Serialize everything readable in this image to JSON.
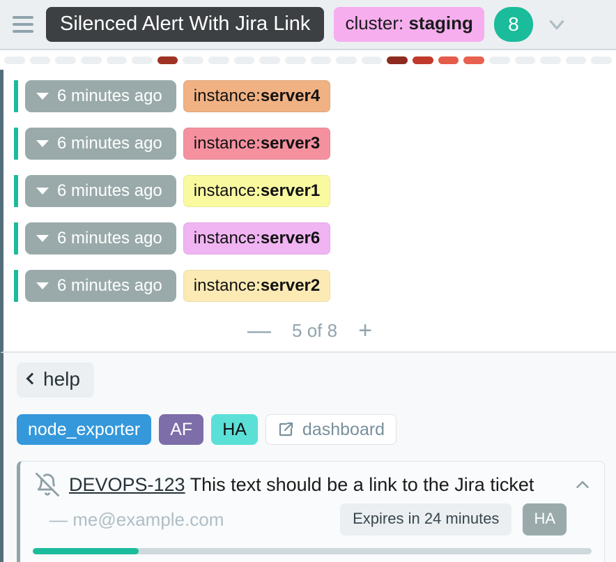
{
  "header": {
    "menu_icon": "hamburger-icon",
    "alert_title": "Silenced Alert With Jira Link",
    "cluster_key": "cluster: ",
    "cluster_value": "staging",
    "count": "8",
    "expand_icon": "chevron-down-icon"
  },
  "timeline": {
    "segments": [
      {
        "color": "#eceff1"
      },
      {
        "color": "#eceff1"
      },
      {
        "color": "#eceff1"
      },
      {
        "color": "#eceff1"
      },
      {
        "color": "#eceff1"
      },
      {
        "color": "#eceff1"
      },
      {
        "color": "#9e3224"
      },
      {
        "color": "#eceff1"
      },
      {
        "color": "#eceff1"
      },
      {
        "color": "#eceff1"
      },
      {
        "color": "#eceff1"
      },
      {
        "color": "#eceff1"
      },
      {
        "color": "#eceff1"
      },
      {
        "color": "#eceff1"
      },
      {
        "color": "#eceff1"
      },
      {
        "color": "#8e2b20"
      },
      {
        "color": "#c0392b"
      },
      {
        "color": "#e35b4a"
      },
      {
        "color": "#e8604e"
      },
      {
        "color": "#eceff1"
      },
      {
        "color": "#eceff1"
      },
      {
        "color": "#eceff1"
      },
      {
        "color": "#eceff1"
      },
      {
        "color": "#eceff1"
      }
    ]
  },
  "alerts": {
    "rows": [
      {
        "time": "6 minutes ago",
        "label_key": "instance: ",
        "label_value": "server4",
        "color": "#f0b183"
      },
      {
        "time": "6 minutes ago",
        "label_key": "instance: ",
        "label_value": "server3",
        "color": "#f5919f"
      },
      {
        "time": "6 minutes ago",
        "label_key": "instance: ",
        "label_value": "server1",
        "color": "#f9f9a0"
      },
      {
        "time": "6 minutes ago",
        "label_key": "instance: ",
        "label_value": "server6",
        "color": "#f0b4f2"
      },
      {
        "time": "6 minutes ago",
        "label_key": "instance: ",
        "label_value": "server2",
        "color": "#fbeab4"
      }
    ]
  },
  "pager": {
    "decrease_label": "—",
    "status": "5 of 8",
    "increase_label": "+"
  },
  "help": {
    "back_icon": "chevron-left-icon",
    "label": "help"
  },
  "tags": [
    {
      "label": "node_exporter",
      "bg": "#3498db",
      "fg": "#ffffff",
      "type": "chip"
    },
    {
      "label": "AF",
      "bg": "#7d6da8",
      "fg": "#ffffff",
      "type": "chip"
    },
    {
      "label": "HA",
      "bg": "#5ae0d6",
      "fg": "#111111",
      "type": "chip"
    },
    {
      "label": "dashboard",
      "bg": "#ffffff",
      "fg": "#78909c",
      "type": "link",
      "icon": "external-link-icon"
    }
  ],
  "silence": {
    "mute_icon": "bell-off-icon",
    "ticket_id": "DEVOPS-123",
    "description": " This text should be a link to the Jira ticket",
    "collapse_icon": "chevron-up-icon",
    "author": "— me@example.com",
    "expires": "Expires in 24 minutes",
    "matcher_badge": "HA",
    "progress_percent": 19,
    "progress_color": "#1bbc9b"
  },
  "colors": {
    "accent_green": "#1bbc9b",
    "panel_bg": "#f7f9fa",
    "list_bg": "#ffffff",
    "header_bg": "#eceff1",
    "left_rail": "#546e7a"
  }
}
